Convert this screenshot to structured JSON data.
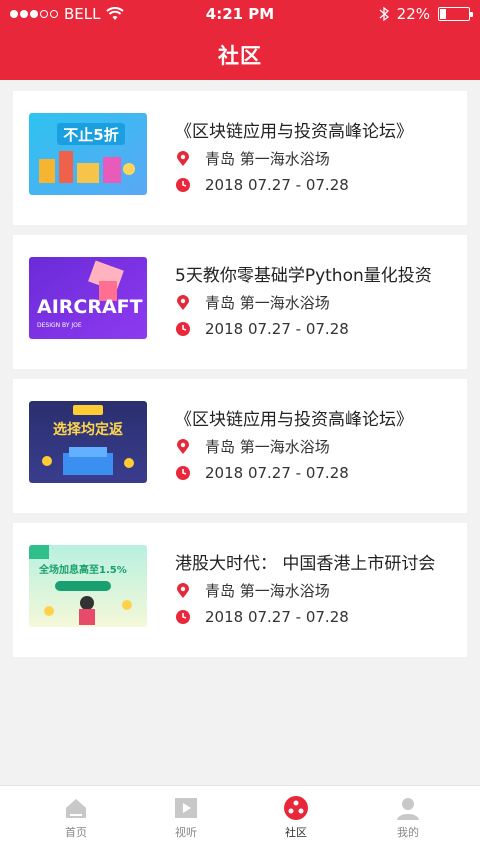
{
  "status": {
    "carrier": "BELL",
    "time": "4:21 PM",
    "battery": "22%"
  },
  "header": {
    "title": "社区"
  },
  "events": [
    {
      "title": "《区块链应用与投资高峰论坛》",
      "location": "青岛 第一海水浴场",
      "date": "2018 07.27 - 07.28",
      "thumb_text": "不止5折"
    },
    {
      "title": "5天教你零基础学Python量化投资",
      "location": "青岛 第一海水浴场",
      "date": "2018 07.27 - 07.28",
      "thumb_text": "AIRCRAFT"
    },
    {
      "title": "《区块链应用与投资高峰论坛》",
      "location": "青岛 第一海水浴场",
      "date": "2018 07.27 - 07.28",
      "thumb_text": "选择均定返"
    },
    {
      "title": "港股大时代： 中国香港上市研讨会",
      "location": "青岛 第一海水浴场",
      "date": "2018 07.27 - 07.28",
      "thumb_text": "全场加息高至1.5%"
    }
  ],
  "tabs": [
    {
      "label": "首页",
      "icon": "home-icon"
    },
    {
      "label": "视听",
      "icon": "play-icon"
    },
    {
      "label": "社区",
      "icon": "community-icon"
    },
    {
      "label": "我的",
      "icon": "profile-icon"
    }
  ],
  "colors": {
    "brand": "#e8283a"
  }
}
